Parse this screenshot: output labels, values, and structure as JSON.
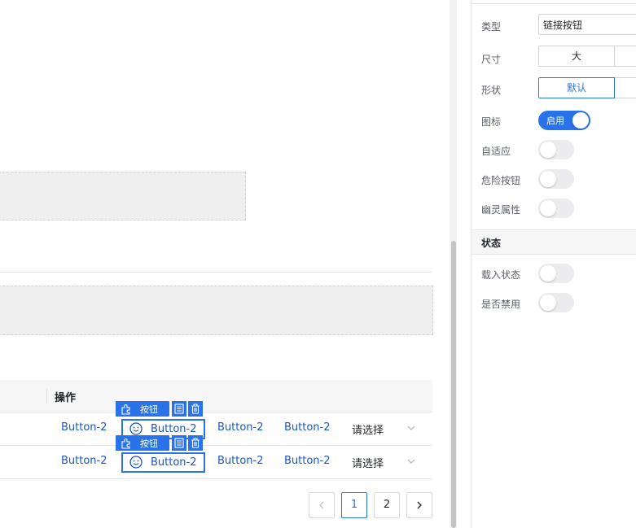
{
  "canvas": {
    "table": {
      "header_op": "操作",
      "rows": [
        {
          "link1": "Button-2",
          "selected_button": "Button-2",
          "link3": "Button-2",
          "link4": "Button-2",
          "select_placeholder": "请选择"
        },
        {
          "link1": "Button-2",
          "selected_button": "Button-2",
          "link3": "Button-2",
          "link4": "Button-2",
          "select_placeholder": "请选择"
        }
      ]
    },
    "selection_toolbar": {
      "tag_label": "按钮"
    },
    "pagination": {
      "pages": [
        "1",
        "2"
      ],
      "current": "1"
    }
  },
  "panel": {
    "type": {
      "label": "类型",
      "value": "链接按钮"
    },
    "size": {
      "label": "尺寸",
      "options": [
        "大"
      ],
      "selected": "大"
    },
    "shape": {
      "label": "形状",
      "options": [
        "默认"
      ],
      "selected": "默认"
    },
    "icon": {
      "label": "图标",
      "toggle_text": "启用",
      "on": true
    },
    "adaptive": {
      "label": "自适应",
      "on": false
    },
    "danger": {
      "label": "危险按钮",
      "on": false
    },
    "ghost": {
      "label": "幽灵属性",
      "on": false
    },
    "state_section": "状态",
    "loading": {
      "label": "载入状态",
      "on": false
    },
    "disabled": {
      "label": "是否禁用",
      "on": false
    }
  },
  "colors": {
    "accent": "#2873ea",
    "link": "#1a55c8"
  }
}
